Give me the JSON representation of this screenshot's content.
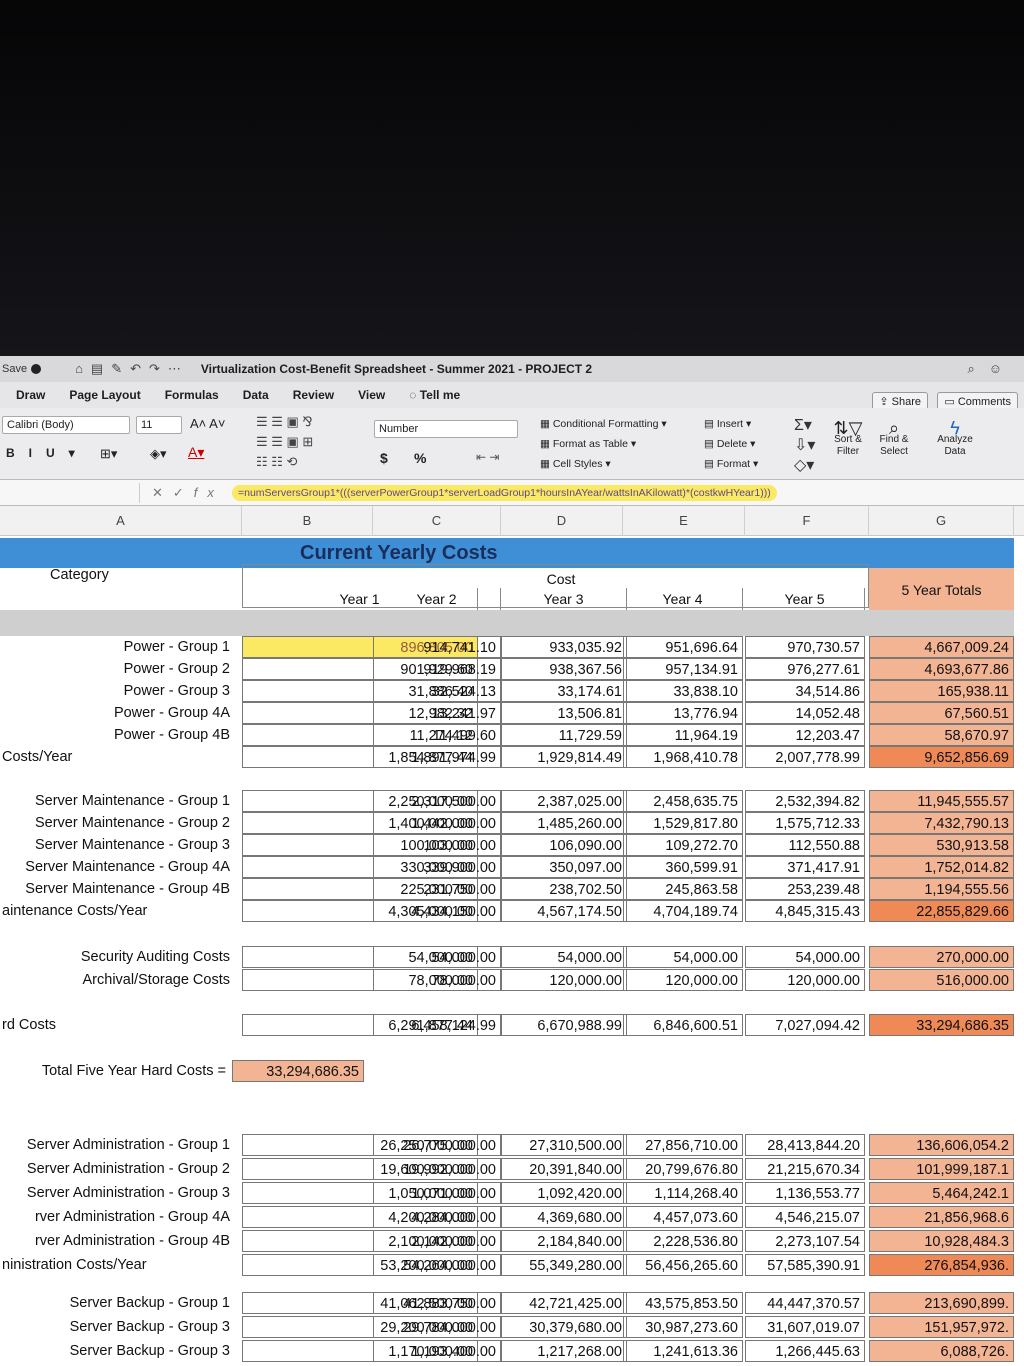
{
  "titlebar": {
    "autosave": "Save",
    "document_title": "Virtualization Cost-Benefit Spreadsheet - Summer 2021 - PROJECT 2"
  },
  "menu": {
    "tabs": [
      "Draw",
      "Page Layout",
      "Formulas",
      "Data",
      "Review",
      "View",
      "Tell me"
    ],
    "share": "Share",
    "comments": "Comments"
  },
  "ribbon": {
    "font_name": "Calibri (Body)",
    "font_size": "11",
    "number_format": "Number",
    "conditional_formatting": "Conditional Formatting",
    "format_as_table": "Format as Table",
    "cell_styles": "Cell Styles",
    "insert": "Insert",
    "delete": "Delete",
    "format": "Format",
    "sort_filter_1": "Sort &",
    "sort_filter_2": "Filter",
    "find_select_1": "Find &",
    "find_select_2": "Select",
    "analyze_1": "Analyze",
    "analyze_2": "Data",
    "currency": "$",
    "percent": "%"
  },
  "formula_bar": {
    "formula": "=numServersGroup1*(((serverPowerGroup1*serverLoadGroup1*hoursInAYear/wattsInAKilowatt)*(costkwHYear1)))"
  },
  "columns": [
    "A",
    "B",
    "C",
    "D",
    "E",
    "F",
    "G"
  ],
  "sheet": {
    "banner": "Current Yearly Costs",
    "category_label": "Category",
    "cost_label": "Cost",
    "years": [
      "Year 1",
      "Year 2",
      "Year 3",
      "Year 4",
      "Year 5"
    ],
    "totals_label": "5 Year Totals",
    "rows": [
      {
        "label": "Power - Group 1",
        "values": [
          "896,805.00",
          "914,741.10",
          "933,035.92",
          "951,696.64",
          "970,730.57"
        ],
        "total": "4,667,009.24"
      },
      {
        "label": "Power - Group 2",
        "values": [
          "901,929.60",
          "919,968.19",
          "938,367.56",
          "957,134.91",
          "976,277.61"
        ],
        "total": "4,693,677.86"
      },
      {
        "label": "Power - Group 3",
        "values": [
          "31,886.40",
          "32,524.13",
          "33,174.61",
          "33,838.10",
          "34,514.86"
        ],
        "total": "165,938.11"
      },
      {
        "label": "Power - Group 4A",
        "values": [
          "12,982.32",
          "13,241.97",
          "13,506.81",
          "13,776.94",
          "14,052.48"
        ],
        "total": "67,560.51"
      },
      {
        "label": "Power - Group 4B",
        "values": [
          "11,274.12",
          "11,499.60",
          "11,729.59",
          "11,964.19",
          "12,203.47"
        ],
        "total": "58,670.97"
      },
      {
        "label": "Costs/Year",
        "values": [
          "1,854,877.44",
          "1,891,974.99",
          "1,929,814.49",
          "1,968,410.78",
          "2,007,778.99"
        ],
        "total": "9,652,856.69"
      },
      {
        "label": "Server Maintenance - Group 1",
        "values": [
          "2,250,000.00",
          "2,317,500.00",
          "2,387,025.00",
          "2,458,635.75",
          "2,532,394.82"
        ],
        "total": "11,945,555.57"
      },
      {
        "label": "Server Maintenance - Group 2",
        "values": [
          "1,400,000.00",
          "1,442,000.00",
          "1,485,260.00",
          "1,529,817.80",
          "1,575,712.33"
        ],
        "total": "7,432,790.13"
      },
      {
        "label": "Server Maintenance - Group 3",
        "values": [
          "100,000.00",
          "103,000.00",
          "106,090.00",
          "109,272.70",
          "112,550.88"
        ],
        "total": "530,913.58"
      },
      {
        "label": "Server Maintenance - Group 4A",
        "values": [
          "330,000.00",
          "339,900.00",
          "350,097.00",
          "360,599.91",
          "371,417.91"
        ],
        "total": "1,752,014.82"
      },
      {
        "label": "Server Maintenance - Group 4B",
        "values": [
          "225,000.00",
          "231,750.00",
          "238,702.50",
          "245,863.58",
          "253,239.48"
        ],
        "total": "1,194,555.56"
      },
      {
        "label": "aintenance Costs/Year",
        "values": [
          "4,305,000.00",
          "4,434,150.00",
          "4,567,174.50",
          "4,704,189.74",
          "4,845,315.43"
        ],
        "total": "22,855,829.66"
      },
      {
        "label": "Security Auditing Costs",
        "values": [
          "54,000.00",
          "54,000.00",
          "54,000.00",
          "54,000.00",
          "54,000.00"
        ],
        "total": "270,000.00"
      },
      {
        "label": "Archival/Storage Costs",
        "values": [
          "78,000.00",
          "78,000.00",
          "120,000.00",
          "120,000.00",
          "120,000.00"
        ],
        "total": "516,000.00"
      },
      {
        "label": "rd Costs",
        "values": [
          "6,291,877.44",
          "6,458,124.99",
          "6,670,988.99",
          "6,846,600.51",
          "7,027,094.42"
        ],
        "total": "33,294,686.35"
      },
      {
        "label": "Server Administration - Group 1",
        "values": [
          "26,250,000.00",
          "26,775,000.00",
          "27,310,500.00",
          "27,856,710.00",
          "28,413,844.20"
        ],
        "total": "136,606,054.2"
      },
      {
        "label": "Server Administration - Group 2",
        "values": [
          "19,600,000.00",
          "19,992,000.00",
          "20,391,840.00",
          "20,799,676.80",
          "21,215,670.34"
        ],
        "total": "101,999,187.1"
      },
      {
        "label": "Server Administration - Group 3",
        "values": [
          "1,050,000.00",
          "1,071,000.00",
          "1,092,420.00",
          "1,114,268.40",
          "1,136,553.77"
        ],
        "total": "5,464,242.1"
      },
      {
        "label": "rver Administration - Group 4A",
        "values": [
          "4,200,000.00",
          "4,284,000.00",
          "4,369,680.00",
          "4,457,073.60",
          "4,546,215.07"
        ],
        "total": "21,856,968.6"
      },
      {
        "label": "rver Administration - Group 4B",
        "values": [
          "2,100,000.00",
          "2,142,000.00",
          "2,184,840.00",
          "2,228,536.80",
          "2,273,107.54"
        ],
        "total": "10,928,484.3"
      },
      {
        "label": "ninistration Costs/Year",
        "values": [
          "53,200,000.00",
          "54,264,000.00",
          "55,349,280.00",
          "56,456,265.60",
          "57,585,390.91"
        ],
        "total": "276,854,936."
      },
      {
        "label": "Server Backup - Group 1",
        "values": [
          "41,062,500.00",
          "41,883,750.00",
          "42,721,425.00",
          "43,575,853.50",
          "44,447,370.57"
        ],
        "total": "213,690,899."
      },
      {
        "label": "Server Backup - Group 3",
        "values": [
          "29,200,000.00",
          "29,784,000.00",
          "30,379,680.00",
          "30,987,273.60",
          "31,607,019.07"
        ],
        "total": "151,957,972."
      },
      {
        "label": "Server Backup - Group 3",
        "values": [
          "1,170,000.00",
          "1,193,400.00",
          "1,217,268.00",
          "1,241,613.36",
          "1,266,445.63"
        ],
        "total": "6,088,726."
      }
    ],
    "total_five_year_label": "Total Five Year Hard Costs =",
    "total_five_year_value": "33,294,686.35"
  }
}
